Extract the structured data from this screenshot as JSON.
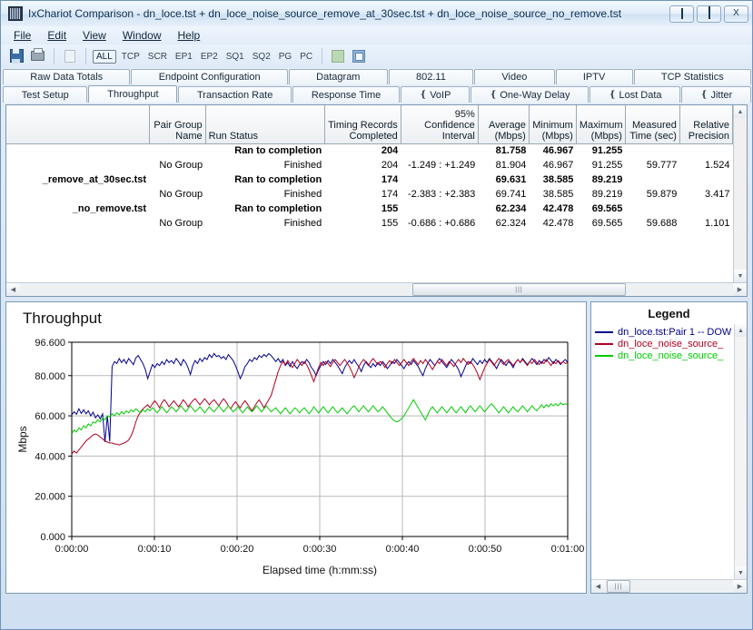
{
  "window": {
    "title": "IxChariot Comparison - dn_loce.tst + dn_loce_noise_source_remove_at_30sec.tst + dn_loce_noise_source_no_remove.tst",
    "minimize_label": "Minimize",
    "maximize_label": "Maximize",
    "close_label": "X"
  },
  "menu": {
    "items": [
      {
        "label": "File"
      },
      {
        "label": "Edit"
      },
      {
        "label": "View"
      },
      {
        "label": "Window"
      },
      {
        "label": "Help"
      }
    ]
  },
  "toolbar": {
    "save_icon": "save-icon",
    "print_icon": "print-icon",
    "copy_icon": "copy-icon",
    "filters": [
      {
        "label": "ALL",
        "active": true
      },
      {
        "label": "TCP",
        "active": false
      },
      {
        "label": "SCR",
        "active": false
      },
      {
        "label": "EP1",
        "active": false
      },
      {
        "label": "EP2",
        "active": false
      },
      {
        "label": "SQ1",
        "active": false
      },
      {
        "label": "SQ2",
        "active": false
      },
      {
        "label": "PG",
        "active": false
      },
      {
        "label": "PC",
        "active": false
      }
    ]
  },
  "tabs_top": [
    {
      "label": "Raw Data Totals"
    },
    {
      "label": "Endpoint Configuration"
    },
    {
      "label": "Datagram"
    },
    {
      "label": "802.11"
    },
    {
      "label": "Video"
    },
    {
      "label": "IPTV"
    },
    {
      "label": "TCP Statistics"
    }
  ],
  "tabs_bottom": [
    {
      "label": "Test Setup",
      "selected": false,
      "clip": false
    },
    {
      "label": "Throughput",
      "selected": true,
      "clip": false
    },
    {
      "label": "Transaction Rate",
      "selected": false,
      "clip": false
    },
    {
      "label": "Response Time",
      "selected": false,
      "clip": false
    },
    {
      "label": "VoIP",
      "selected": false,
      "clip": true
    },
    {
      "label": "One-Way Delay",
      "selected": false,
      "clip": true
    },
    {
      "label": "Lost Data",
      "selected": false,
      "clip": true
    },
    {
      "label": "Jitter",
      "selected": false,
      "clip": true
    }
  ],
  "grid": {
    "columns": [
      "",
      "Pair Group\nName",
      "Run Status",
      "Timing Records\nCompleted",
      "95% Confidence\nInterval",
      "Average\n(Mbps)",
      "Minimum\n(Mbps)",
      "Maximum\n(Mbps)",
      "Measured\nTime (sec)",
      "Relative\nPrecision"
    ],
    "columns_flat": {
      "blank": "",
      "pair_group_name_1": "Pair Group",
      "pair_group_name_2": "Name",
      "run_status": "Run Status",
      "timing_records_1": "Timing Records",
      "timing_records_2": "Completed",
      "confidence_1": "95% Confidence",
      "confidence_2": "Interval",
      "average_1": "Average",
      "average_2": "(Mbps)",
      "minimum_1": "Minimum",
      "minimum_2": "(Mbps)",
      "maximum_1": "Maximum",
      "maximum_2": "(Mbps)",
      "measured_1": "Measured",
      "measured_2": "Time (sec)",
      "relative_1": "Relative",
      "relative_2": "Precision"
    },
    "rows": [
      {
        "name": "",
        "group": "",
        "status": "Ran to completion",
        "records": "204",
        "confidence": "",
        "average": "81.758",
        "minimum": "46.967",
        "maximum": "91.255",
        "measured": "",
        "precision": "",
        "bold": true
      },
      {
        "name": "",
        "group": "No Group",
        "status": "Finished",
        "records": "204",
        "confidence": "-1.249 : +1.249",
        "average": "81.904",
        "minimum": "46.967",
        "maximum": "91.255",
        "measured": "59.777",
        "precision": "1.524",
        "bold": false
      },
      {
        "name": "_remove_at_30sec.tst",
        "group": "",
        "status": "Ran to completion",
        "records": "174",
        "confidence": "",
        "average": "69.631",
        "minimum": "38.585",
        "maximum": "89.219",
        "measured": "",
        "precision": "",
        "bold": true
      },
      {
        "name": "",
        "group": "No Group",
        "status": "Finished",
        "records": "174",
        "confidence": "-2.383 : +2.383",
        "average": "69.741",
        "minimum": "38.585",
        "maximum": "89.219",
        "measured": "59.879",
        "precision": "3.417",
        "bold": false
      },
      {
        "name": "_no_remove.tst",
        "group": "",
        "status": "Ran to completion",
        "records": "155",
        "confidence": "",
        "average": "62.234",
        "minimum": "42.478",
        "maximum": "69.565",
        "measured": "",
        "precision": "",
        "bold": true
      },
      {
        "name": "",
        "group": "No Group",
        "status": "Finished",
        "records": "155",
        "confidence": "-0.686 : +0.686",
        "average": "62.324",
        "minimum": "42.478",
        "maximum": "69.565",
        "measured": "59.688",
        "precision": "1.101",
        "bold": false
      }
    ]
  },
  "legend": {
    "title": "Legend",
    "items": [
      {
        "label": "dn_loce.tst:Pair 1 -- DOW",
        "color": "#00008b"
      },
      {
        "label": "dn_loce_noise_source_",
        "color": "#b00020"
      },
      {
        "label": "dn_loce_noise_source_",
        "color": "#00cc00"
      }
    ]
  },
  "chart_data": {
    "type": "line",
    "title": "Throughput",
    "xlabel": "Elapsed time (h:mm:ss)",
    "ylabel": "Mbps",
    "ylim": [
      0,
      96.6
    ],
    "xlim": [
      0,
      60
    ],
    "grid": true,
    "legend_position": "right-panel",
    "ytick_labels": [
      "0.000",
      "20.000",
      "40.000",
      "60.000",
      "80.000",
      "96.600"
    ],
    "ytick_values": [
      0,
      20,
      40,
      60,
      80,
      96.6
    ],
    "xtick_labels": [
      "0:00:00",
      "0:00:10",
      "0:00:20",
      "0:00:30",
      "0:00:40",
      "0:00:50",
      "0:01:00"
    ],
    "xtick_values": [
      0,
      10,
      20,
      30,
      40,
      50,
      60
    ],
    "series": [
      {
        "name": "dn_loce.tst:Pair 1 -- DOW",
        "color": "#00008b",
        "values": [
          60.5,
          62.0,
          60.8,
          63.5,
          61.2,
          63.0,
          61.0,
          62.5,
          60.0,
          61.8,
          59.0,
          60.5,
          58.5,
          61.0,
          47.0,
          60.0,
          47.2,
          84.5,
          87.0,
          86.0,
          88.5,
          86.5,
          88.0,
          86.0,
          88.5,
          87.0,
          85.5,
          88.8,
          90.0,
          88.0,
          86.0,
          83.0,
          78.5,
          82.0,
          85.5,
          84.0,
          86.0,
          85.0,
          87.0,
          85.5,
          88.0,
          86.5,
          87.5,
          86.0,
          88.5,
          87.0,
          85.0,
          88.0,
          86.5,
          84.0,
          80.5,
          85.0,
          87.5,
          86.0,
          88.5,
          87.0,
          89.0,
          88.0,
          90.5,
          89.0,
          91.0,
          89.5,
          90.0,
          88.5,
          89.5,
          88.0,
          90.5,
          89.0,
          87.5,
          85.0,
          82.0,
          78.5,
          81.0,
          84.5,
          86.0,
          88.0,
          87.0,
          89.0,
          88.0,
          90.0,
          89.0,
          90.5,
          89.5,
          91.0,
          90.0,
          88.5,
          87.0,
          88.5,
          86.5,
          88.0,
          85.0,
          86.5,
          84.5,
          87.0,
          85.0,
          83.5,
          85.5,
          87.0,
          86.0,
          88.0,
          86.5,
          84.0,
          82.5,
          80.0,
          83.0,
          85.0,
          87.0,
          85.5,
          87.5,
          86.0,
          88.0,
          86.5,
          85.0,
          83.0,
          81.0,
          84.0,
          86.0,
          87.5,
          86.0,
          88.0,
          86.0,
          84.5,
          82.0,
          85.0,
          87.0,
          85.5,
          84.0,
          86.0,
          84.5,
          86.5,
          85.0,
          87.0,
          85.5,
          83.5,
          85.0,
          87.0,
          86.0,
          88.0,
          86.5,
          85.0,
          83.5,
          85.5,
          87.0,
          85.5,
          87.5,
          86.0,
          84.5,
          82.0,
          80.0,
          83.5,
          86.0,
          88.0,
          86.5,
          85.0,
          87.0,
          88.5,
          87.0,
          85.5,
          84.0,
          86.0,
          88.0,
          86.5,
          85.0,
          83.0,
          79.5,
          82.0,
          85.0,
          87.0,
          86.0,
          88.5,
          87.0,
          85.5,
          87.5,
          86.0,
          88.0,
          86.5,
          88.5,
          87.0,
          85.5,
          83.5,
          86.0,
          88.0,
          86.5,
          85.0,
          87.0,
          86.0,
          84.0,
          86.5,
          88.0,
          86.5,
          88.5,
          87.0,
          85.5,
          87.0,
          88.5,
          87.0,
          85.5,
          87.5,
          86.0,
          88.0,
          87.0,
          89.0,
          87.5,
          86.0,
          88.0,
          87.0,
          85.5,
          87.0,
          88.0,
          86.5
        ]
      },
      {
        "name": "dn_loce_noise_source_remove_at_30sec.tst",
        "color": "#b00020",
        "values": [
          41.0,
          42.5,
          41.5,
          43.0,
          44.5,
          46.0,
          47.5,
          48.5,
          49.5,
          50.5,
          51.0,
          50.5,
          49.5,
          48.5,
          47.5,
          47.0,
          46.5,
          46.5,
          46.0,
          46.0,
          45.5,
          46.0,
          46.5,
          47.0,
          48.0,
          50.0,
          53.0,
          57.0,
          60.0,
          62.0,
          63.5,
          64.5,
          65.5,
          64.0,
          66.0,
          67.5,
          66.0,
          64.0,
          66.5,
          68.0,
          66.5,
          64.5,
          66.0,
          67.5,
          66.0,
          64.5,
          66.0,
          68.0,
          66.5,
          64.5,
          66.0,
          67.5,
          68.5,
          67.0,
          65.5,
          67.0,
          68.5,
          67.0,
          65.5,
          67.0,
          68.0,
          66.5,
          65.0,
          67.0,
          68.5,
          67.0,
          65.0,
          63.5,
          65.5,
          67.0,
          65.5,
          64.0,
          66.0,
          67.5,
          66.0,
          64.0,
          62.5,
          64.5,
          66.5,
          68.0,
          66.0,
          64.0,
          66.0,
          68.0,
          70.0,
          74.0,
          78.0,
          82.0,
          85.0,
          87.0,
          85.5,
          87.5,
          86.0,
          84.0,
          86.0,
          88.0,
          86.5,
          85.0,
          87.0,
          85.5,
          83.0,
          80.0,
          77.0,
          80.5,
          84.0,
          86.5,
          85.0,
          87.0,
          86.0,
          84.5,
          86.5,
          88.0,
          86.5,
          85.0,
          86.5,
          88.0,
          86.5,
          84.5,
          82.0,
          79.0,
          81.5,
          84.5,
          86.5,
          88.0,
          86.5,
          85.0,
          87.0,
          88.5,
          87.0,
          85.5,
          87.0,
          86.0,
          84.0,
          86.0,
          87.5,
          86.0,
          88.0,
          86.5,
          85.0,
          86.5,
          88.0,
          86.5,
          85.0,
          87.0,
          88.5,
          87.0,
          85.5,
          87.5,
          86.0,
          88.0,
          86.5,
          85.0,
          83.0,
          85.0,
          87.0,
          86.0,
          88.0,
          86.5,
          85.0,
          87.0,
          86.0,
          84.5,
          86.5,
          88.0,
          86.5,
          88.5,
          87.0,
          85.5,
          87.0,
          85.5,
          83.5,
          81.0,
          78.0,
          81.0,
          84.0,
          86.0,
          88.0,
          86.5,
          85.0,
          87.0,
          88.5,
          87.0,
          85.5,
          87.0,
          88.0,
          86.5,
          85.0,
          86.5,
          88.0,
          86.5,
          88.0,
          86.5,
          85.0,
          87.0,
          86.0,
          88.0,
          86.5,
          85.5,
          87.0,
          86.0,
          88.0,
          86.5,
          85.0,
          87.0,
          86.0,
          87.5,
          86.0,
          87.0,
          86.0,
          86.5
        ]
      },
      {
        "name": "dn_loce_noise_source_no_remove.tst",
        "color": "#00cc00",
        "values": [
          51.0,
          53.0,
          52.0,
          54.0,
          53.0,
          55.0,
          54.0,
          56.0,
          55.0,
          57.0,
          56.5,
          58.0,
          57.0,
          59.0,
          58.0,
          60.0,
          59.5,
          61.0,
          60.0,
          61.5,
          60.5,
          62.0,
          61.0,
          62.5,
          61.5,
          63.0,
          62.0,
          63.5,
          62.5,
          61.5,
          63.0,
          62.0,
          63.5,
          62.5,
          64.0,
          63.0,
          61.5,
          63.0,
          64.5,
          63.0,
          61.5,
          63.0,
          64.5,
          63.5,
          62.0,
          63.5,
          65.0,
          63.5,
          62.0,
          63.5,
          65.0,
          63.5,
          62.0,
          63.0,
          64.5,
          63.0,
          61.5,
          63.0,
          64.5,
          63.0,
          62.0,
          63.5,
          65.0,
          63.5,
          62.0,
          63.5,
          65.0,
          63.5,
          62.0,
          63.0,
          64.5,
          63.0,
          61.5,
          63.0,
          64.5,
          63.0,
          62.0,
          63.5,
          65.0,
          63.5,
          62.0,
          63.5,
          65.0,
          63.5,
          62.0,
          63.0,
          64.0,
          62.5,
          61.0,
          62.5,
          64.0,
          62.5,
          61.0,
          62.5,
          64.0,
          63.0,
          61.5,
          63.0,
          64.0,
          62.5,
          61.0,
          62.5,
          64.5,
          63.0,
          61.5,
          63.0,
          64.5,
          63.0,
          61.5,
          63.0,
          64.5,
          63.0,
          61.5,
          62.5,
          64.0,
          62.5,
          61.0,
          62.5,
          64.0,
          65.0,
          63.5,
          62.0,
          63.5,
          65.0,
          63.5,
          62.0,
          63.5,
          65.0,
          63.5,
          62.0,
          63.0,
          64.5,
          63.0,
          61.5,
          60.0,
          58.5,
          57.5,
          57.0,
          57.5,
          58.5,
          60.0,
          62.0,
          64.0,
          66.0,
          68.0,
          66.0,
          64.0,
          62.0,
          60.0,
          58.0,
          60.5,
          63.0,
          64.5,
          63.0,
          61.5,
          63.0,
          64.5,
          63.0,
          61.5,
          63.0,
          64.5,
          63.0,
          61.5,
          63.0,
          64.5,
          63.0,
          61.5,
          63.5,
          65.0,
          63.5,
          62.0,
          63.5,
          65.0,
          63.5,
          62.0,
          63.5,
          65.0,
          66.0,
          64.5,
          63.0,
          61.5,
          63.0,
          64.5,
          63.0,
          61.5,
          63.0,
          64.5,
          63.0,
          62.0,
          63.5,
          65.0,
          63.5,
          62.0,
          63.5,
          65.0,
          63.5,
          62.5,
          64.0,
          65.5,
          64.0,
          65.5,
          64.5,
          66.0,
          65.0,
          66.0,
          65.0,
          66.5,
          65.5,
          66.0,
          65.5
        ]
      }
    ]
  }
}
